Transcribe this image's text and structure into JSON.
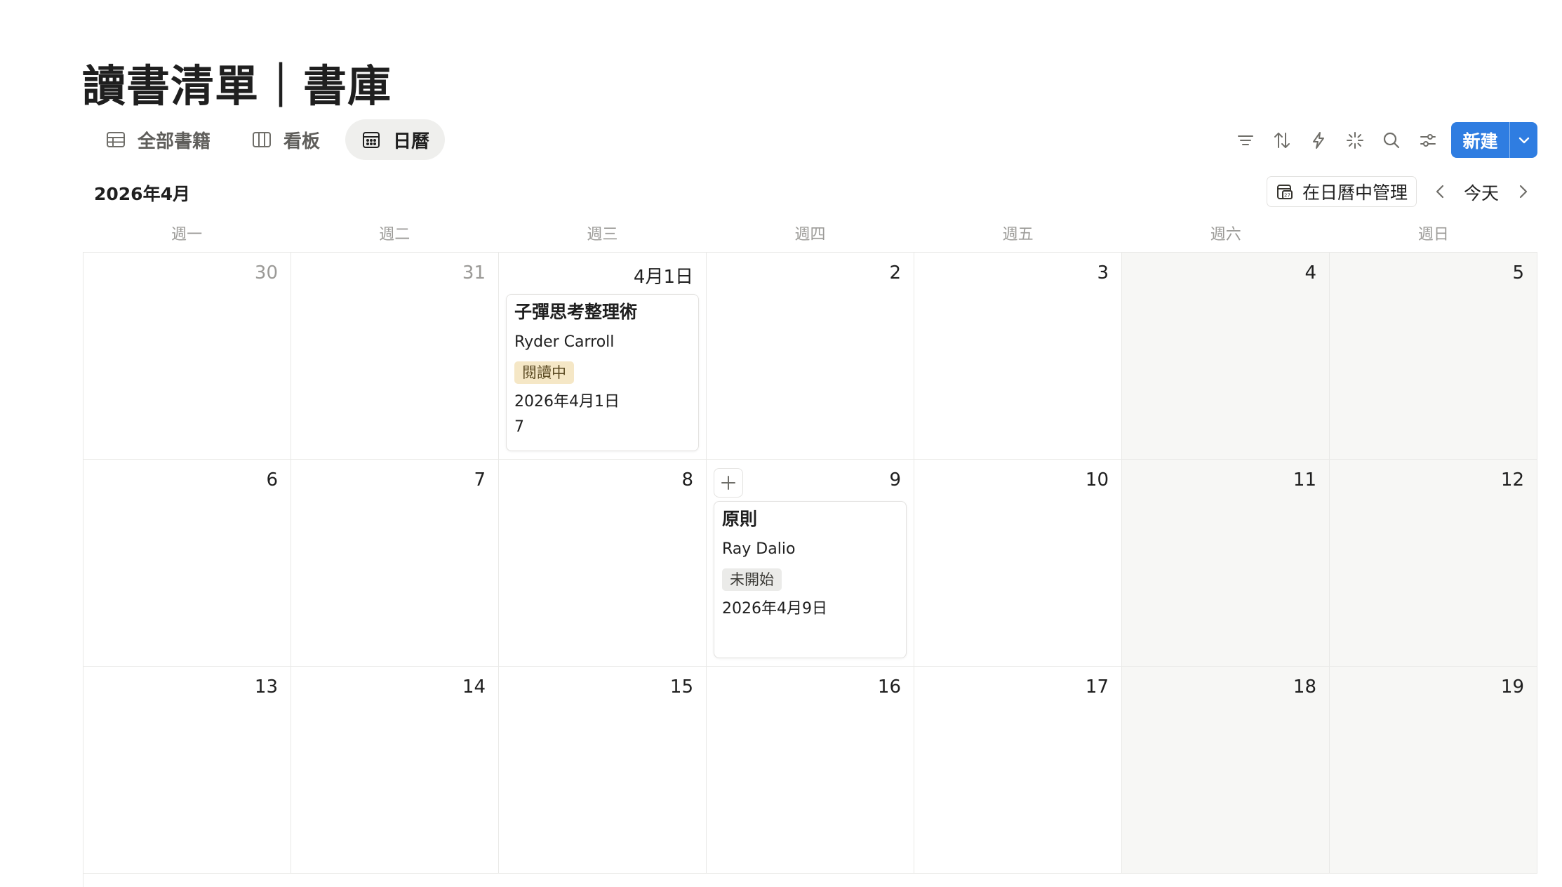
{
  "page": {
    "title": "讀書清單｜書庫"
  },
  "tabs": [
    {
      "label": "全部書籍",
      "icon": "table-icon",
      "active": false
    },
    {
      "label": "看板",
      "icon": "board-icon",
      "active": false
    },
    {
      "label": "日曆",
      "icon": "calendar-icon",
      "active": true
    }
  ],
  "toolbar": {
    "tools": [
      "filter-icon",
      "sort-icon",
      "automation-lightning-icon",
      "ai-sparkle-icon",
      "search-icon",
      "settings-sliders-icon"
    ],
    "new_label": "新建",
    "accent": "#2f7de1"
  },
  "calendar": {
    "month_label": "2026年4月",
    "manage_label": "在日曆中管理",
    "today_label": "今天",
    "weekdays": [
      "週一",
      "週二",
      "週三",
      "週四",
      "週五",
      "週六",
      "週日"
    ],
    "weeks": [
      [
        "30",
        "31",
        "4月1日",
        "2",
        "3",
        "4",
        "5"
      ],
      [
        "6",
        "7",
        "8",
        "9",
        "10",
        "11",
        "12"
      ],
      [
        "13",
        "14",
        "15",
        "16",
        "17",
        "18",
        "19"
      ]
    ],
    "cards": {
      "book1": {
        "title": "子彈思考整理術",
        "author": "Ryder Carroll",
        "status": "閱讀中",
        "date": "2026年4月1日",
        "number": "7"
      },
      "book2": {
        "title": "原則",
        "author": "Ray Dalio",
        "status": "未開始",
        "date": "2026年4月9日"
      }
    }
  }
}
